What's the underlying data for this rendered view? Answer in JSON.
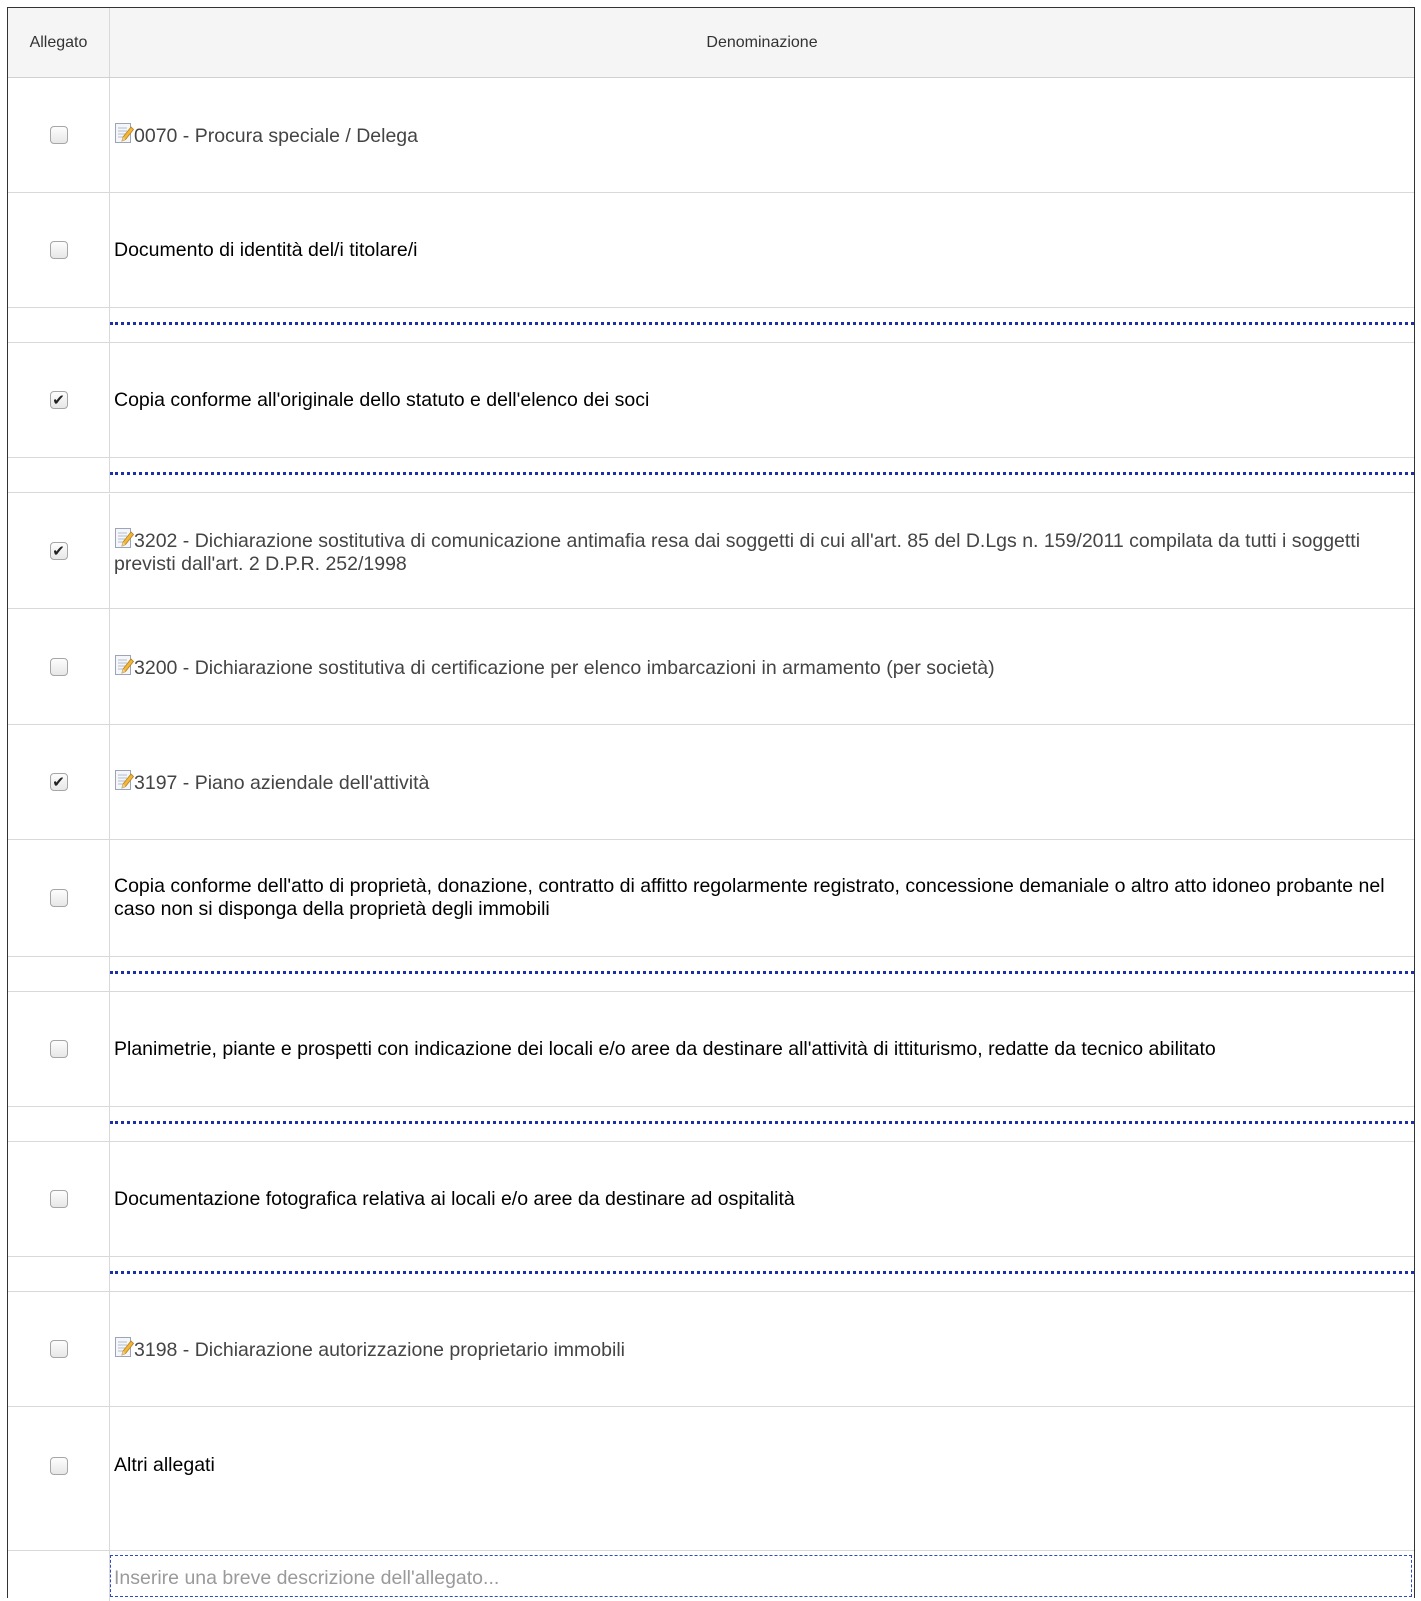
{
  "header": {
    "col_allegato": "Allegato",
    "col_denominazione": "Denominazione"
  },
  "items": [
    {
      "label": "0070 - Procura speciale / Delega",
      "checked": false,
      "icon": "edit-document-icon"
    },
    {
      "label": "Documento di identità del/i titolare/i",
      "checked": false,
      "icon": null
    },
    {
      "label": "Copia conforme all'originale dello statuto e dell'elenco dei soci",
      "checked": true,
      "icon": null
    },
    {
      "label": "3202 - Dichiarazione sostitutiva di comunicazione antimafia resa dai soggetti di cui all'art. 85 del D.Lgs n. 159/2011 compilata da tutti i soggetti previsti dall'art. 2 D.P.R. 252/1998",
      "checked": true,
      "icon": "edit-document-icon"
    },
    {
      "label": "3200 - Dichiarazione sostitutiva di certificazione per elenco imbarcazioni in armamento (per società)",
      "checked": false,
      "icon": "edit-document-icon"
    },
    {
      "label": "3197 - Piano aziendale dell'attività",
      "checked": true,
      "icon": "edit-document-icon"
    },
    {
      "label": "Copia conforme dell'atto di proprietà, donazione, contratto di affitto regolarmente registrato, concessione demaniale o altro atto idoneo probante nel caso non si disponga della proprietà degli immobili",
      "checked": false,
      "icon": null
    },
    {
      "label": "Planimetrie, piante e prospetti con indicazione dei locali e/o aree da destinare all'attività di ittiturismo, redatte da tecnico abilitato",
      "checked": false,
      "icon": null
    },
    {
      "label": "Documentazione fotografica relativa ai locali e/o aree da destinare ad ospitalità",
      "checked": false,
      "icon": null
    },
    {
      "label": "3198 - Dichiarazione autorizzazione proprietario immobili",
      "checked": false,
      "icon": "edit-document-icon"
    },
    {
      "label": "Altri allegati",
      "checked": false,
      "icon": null
    }
  ],
  "description_input": {
    "placeholder": "Inserire una breve descrizione dell'allegato...",
    "value": ""
  },
  "colors": {
    "dotted_separator": "#1a2fa8",
    "input_border": "#2c4bbd",
    "header_bg": "#f5f5f5"
  }
}
